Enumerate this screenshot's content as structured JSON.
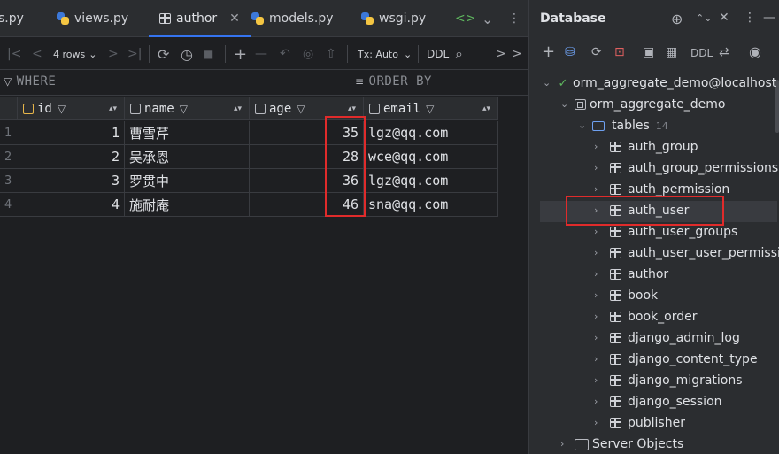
{
  "tabs": [
    {
      "label": "s.py",
      "icon": "python-file-icon"
    },
    {
      "label": "views.py",
      "icon": "python-file-icon"
    },
    {
      "label": "author",
      "icon": "table-icon",
      "active": true,
      "close": "✕"
    },
    {
      "label": "models.py",
      "icon": "python-file-icon"
    },
    {
      "label": "wsgi.py",
      "icon": "python-file-icon"
    }
  ],
  "tab_actions": {
    "code": "<>",
    "more": "⌄"
  },
  "toolbar": {
    "first": "|<",
    "prev": "<",
    "rows": "4 rows",
    "rows_chevron": "⌄",
    "next": ">",
    "last": ">|",
    "refresh": "⟳",
    "history": "◷",
    "stop": "■",
    "add": "+",
    "remove": "—",
    "revert": "↶",
    "preview": "◎",
    "submit": "⇧",
    "tx": "Tx: Auto",
    "tx_chevron": "⌄",
    "ddl": "DDL",
    "search": "⌕",
    "nav_prev": ">",
    "nav_next": ">"
  },
  "filter": {
    "where": "WHERE",
    "order_by": "ORDER BY"
  },
  "columns": [
    "id",
    "name",
    "age",
    "email"
  ],
  "rows": [
    {
      "n": "1",
      "id": "1",
      "name": "曹雪芹",
      "age": "35",
      "email": "lgz@qq.com"
    },
    {
      "n": "2",
      "id": "2",
      "name": "吴承恩",
      "age": "28",
      "email": "wce@qq.com"
    },
    {
      "n": "3",
      "id": "3",
      "name": "罗贯中",
      "age": "36",
      "email": "lgz@qq.com"
    },
    {
      "n": "4",
      "id": "4",
      "name": "施耐庵",
      "age": "46",
      "email": "sna@qq.com"
    }
  ],
  "db_panel": {
    "title": "Database",
    "header_buttons": [
      "⊕",
      "⌃⌄",
      "✕",
      "⋮",
      "—"
    ],
    "toolbar": [
      "+",
      "⛁",
      "⟳",
      "⊡",
      "▣",
      "▦",
      "DDL",
      "⇄",
      "◉"
    ],
    "datasource": "orm_aggregate_demo@localhost",
    "schema": "orm_aggregate_demo",
    "tables_label": "tables",
    "tables_count": "14",
    "tables": [
      "auth_group",
      "auth_group_permissions",
      "auth_permission",
      "auth_user",
      "auth_user_groups",
      "auth_user_user_permissions",
      "author",
      "book",
      "book_order",
      "django_admin_log",
      "django_content_type",
      "django_migrations",
      "django_session",
      "publisher"
    ],
    "server_objects": "Server Objects"
  }
}
